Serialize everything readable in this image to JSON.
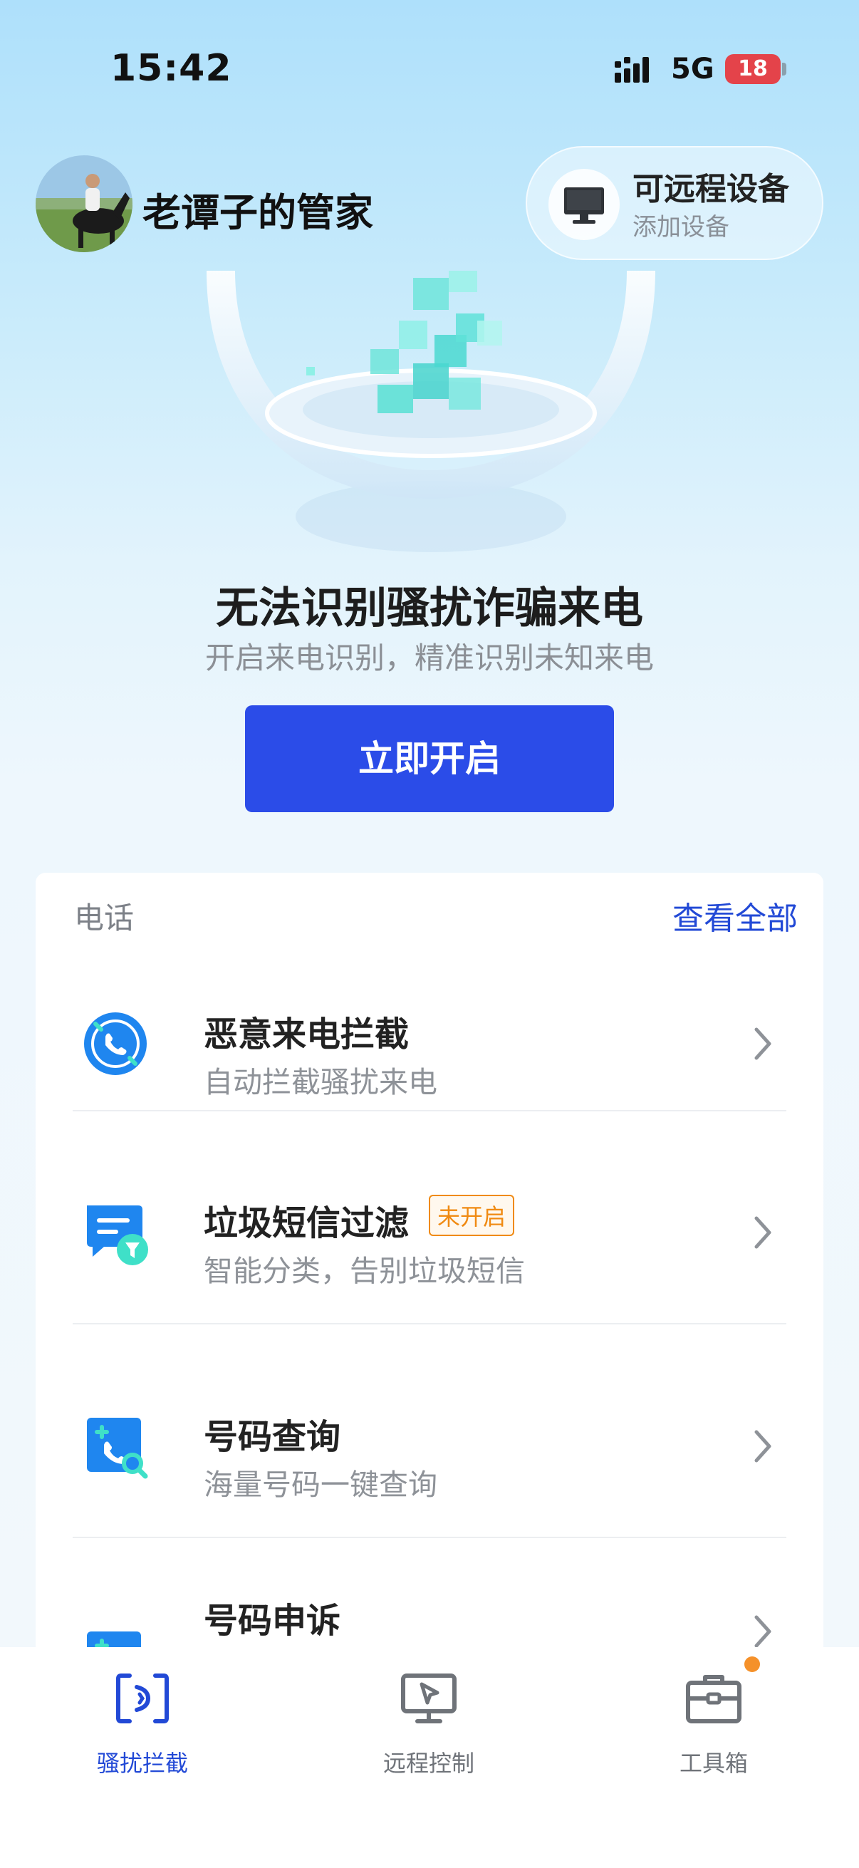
{
  "status_bar": {
    "time": "15:42",
    "network": "5G",
    "battery": "18"
  },
  "header": {
    "user_name": "老谭子的管家",
    "remote_title": "可远程设备",
    "remote_sub": "添加设备"
  },
  "hero": {
    "title": "无法识别骚扰诈骗来电",
    "subtitle": "开启来电识别，精准识别未知来电",
    "button_label": "立即开启"
  },
  "phone_section": {
    "label": "电话",
    "view_all": "查看全部",
    "items": [
      {
        "title": "恶意来电拦截",
        "subtitle": "自动拦截骚扰来电",
        "icon": "phone-block-icon"
      },
      {
        "title": "垃圾短信过滤",
        "subtitle": "智能分类，告别垃圾短信",
        "badge": "未开启",
        "icon": "sms-filter-icon"
      },
      {
        "title": "号码查询",
        "subtitle": "海量号码一键查询",
        "icon": "number-search-icon"
      },
      {
        "title": "号码申诉",
        "icon": "number-appeal-icon"
      }
    ]
  },
  "bottom_nav": {
    "items": [
      {
        "label": "骚扰拦截",
        "active": true
      },
      {
        "label": "远程控制",
        "active": false
      },
      {
        "label": "工具箱",
        "active": false
      }
    ]
  },
  "colors": {
    "accent": "#2b4ce8",
    "badge": "#f08a12",
    "battery": "#e4434a"
  }
}
